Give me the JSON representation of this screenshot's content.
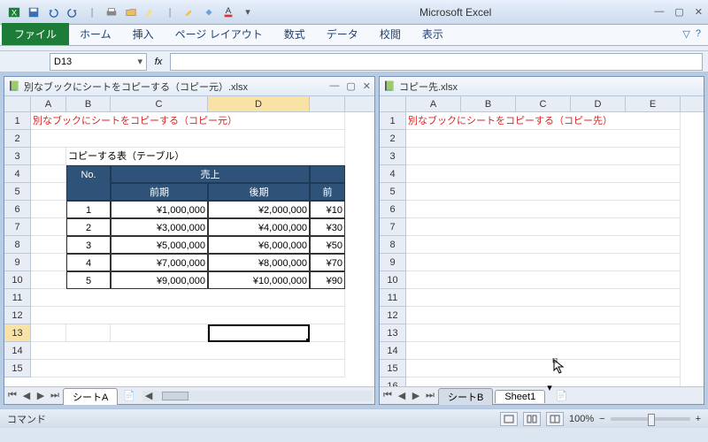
{
  "app_title": "Microsoft Excel",
  "file_tab": "ファイル",
  "tabs": [
    "ホーム",
    "挿入",
    "ページ レイアウト",
    "数式",
    "データ",
    "校閲",
    "表示"
  ],
  "namebox": "D13",
  "fx_label": "fx",
  "workbooks": [
    {
      "title": "別なブックにシートをコピーする（コピー元）.xlsx",
      "heading_text": "別なブックにシートをコピーする（コピー元）",
      "table_caption": "コピーする表（テーブル）",
      "columns": [
        "A",
        "B",
        "C",
        "D"
      ],
      "header_no": "No.",
      "header_sales": "売上",
      "header_prev": "前期",
      "header_curr": "後期",
      "header_prev2": "前",
      "rows": [
        {
          "no": "1",
          "prev": "¥1,000,000",
          "curr": "¥2,000,000",
          "ext": "¥10"
        },
        {
          "no": "2",
          "prev": "¥3,000,000",
          "curr": "¥4,000,000",
          "ext": "¥30"
        },
        {
          "no": "3",
          "prev": "¥5,000,000",
          "curr": "¥6,000,000",
          "ext": "¥50"
        },
        {
          "no": "4",
          "prev": "¥7,000,000",
          "curr": "¥8,000,000",
          "ext": "¥70"
        },
        {
          "no": "5",
          "prev": "¥9,000,000",
          "curr": "¥10,000,000",
          "ext": "¥90"
        }
      ],
      "sheet_tabs": [
        "シートA"
      ]
    },
    {
      "title": "コピー先.xlsx",
      "heading_text": "別なブックにシートをコピーする（コピー先）",
      "columns": [
        "A",
        "B",
        "C",
        "D",
        "E"
      ],
      "sheet_tabs": [
        "シートB",
        "Sheet1"
      ]
    }
  ],
  "status_text": "コマンド",
  "zoom": "100%"
}
